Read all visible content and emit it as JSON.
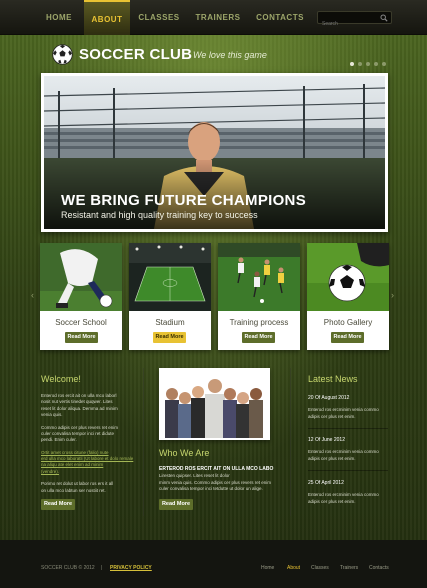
{
  "nav": {
    "items": [
      {
        "label": "HOME",
        "active": false
      },
      {
        "label": "ABOUT",
        "active": true
      },
      {
        "label": "CLASSES",
        "active": false
      },
      {
        "label": "TRAINERS",
        "active": false
      },
      {
        "label": "CONTACTS",
        "active": false
      }
    ],
    "search_placeholder": "Search",
    "search_icon": "search-icon"
  },
  "brand": {
    "name": "SOCCER CLUB",
    "tagline": "We love this game",
    "logo_icon": "soccer-ball-icon"
  },
  "slider": {
    "title": "WE BRING FUTURE CHAMPIONS",
    "subtitle": "Resistant and high quality training key to success",
    "dots": 5,
    "active_dot": 1
  },
  "cards": [
    {
      "title": "Soccer School",
      "button": "Read More",
      "button_style": "green"
    },
    {
      "title": "Stadium",
      "button": "Read More",
      "button_style": "yellow"
    },
    {
      "title": "Training process",
      "button": "Read More",
      "button_style": "green"
    },
    {
      "title": "Photo Gallery",
      "button": "Read More",
      "button_style": "green"
    }
  ],
  "welcome": {
    "title": "Welcome!",
    "lines": [
      "Enterod ros ercit ait on ulla mco laborl",
      "nosit nut vertis tinedet quqwer. Lites",
      "reset lit dolor aliqua. Demma ad minim",
      "venia quis.",
      "",
      "Commo adipis cer plus revers ret enim",
      "culer convalisa tempor inci ret didute",
      "pendi. Enim culer.",
      "",
      "Ortit amet cross citune (falio) nute",
      "erd ulla mco laboratli (Ut labore et dolo remale",
      "na aliqu ate elet enim ad minim",
      "(vendre).",
      "",
      "Porimo ret dolut ut labor ros ers it all",
      "on ulla mco labtun ser nostiit ret."
    ],
    "link_lines": [
      9,
      10,
      11,
      12
    ],
    "button": "Read More"
  },
  "who": {
    "title": "Who We Are",
    "subhead": "ERTEROD ROS ERCIT AIT ON ULLA MCO LABO",
    "lines": [
      "Liresten quipser. Lites reset lit dolor",
      "minm venia quis. Commo adipis cer plus revers ret enim",
      "culer convalisa tempor inci tetdutte ut dolor un alige."
    ],
    "button": "Read More"
  },
  "news": {
    "title": "Latest News",
    "items": [
      {
        "date": "20 Of August 2012",
        "lines": [
          "Enterod ros ercminim venia commo",
          "adipis cer plus  ret enim."
        ]
      },
      {
        "date": "12 Of June 2012",
        "lines": [
          "Enterod ros ercminim venia commo",
          "adipis cer plus  ret enim."
        ]
      },
      {
        "date": "25 Of April 2012",
        "lines": [
          "Enterod ros ercminim venia commo",
          "adipis cer plus  ret enim."
        ]
      }
    ]
  },
  "footer": {
    "copyright": "SOCCER CLUB © 2012",
    "separator": "|",
    "policy": "PRIVACY POLICY",
    "nav": [
      {
        "label": "Home",
        "active": false
      },
      {
        "label": "About",
        "active": true
      },
      {
        "label": "Classes",
        "active": false
      },
      {
        "label": "Trainers",
        "active": false
      },
      {
        "label": "Contacts",
        "active": false
      }
    ]
  },
  "colors": {
    "accent": "#e8c233",
    "button_green": "#5d6d2a",
    "heading_green": "#c6d66e",
    "footer_bg": "#141510"
  }
}
